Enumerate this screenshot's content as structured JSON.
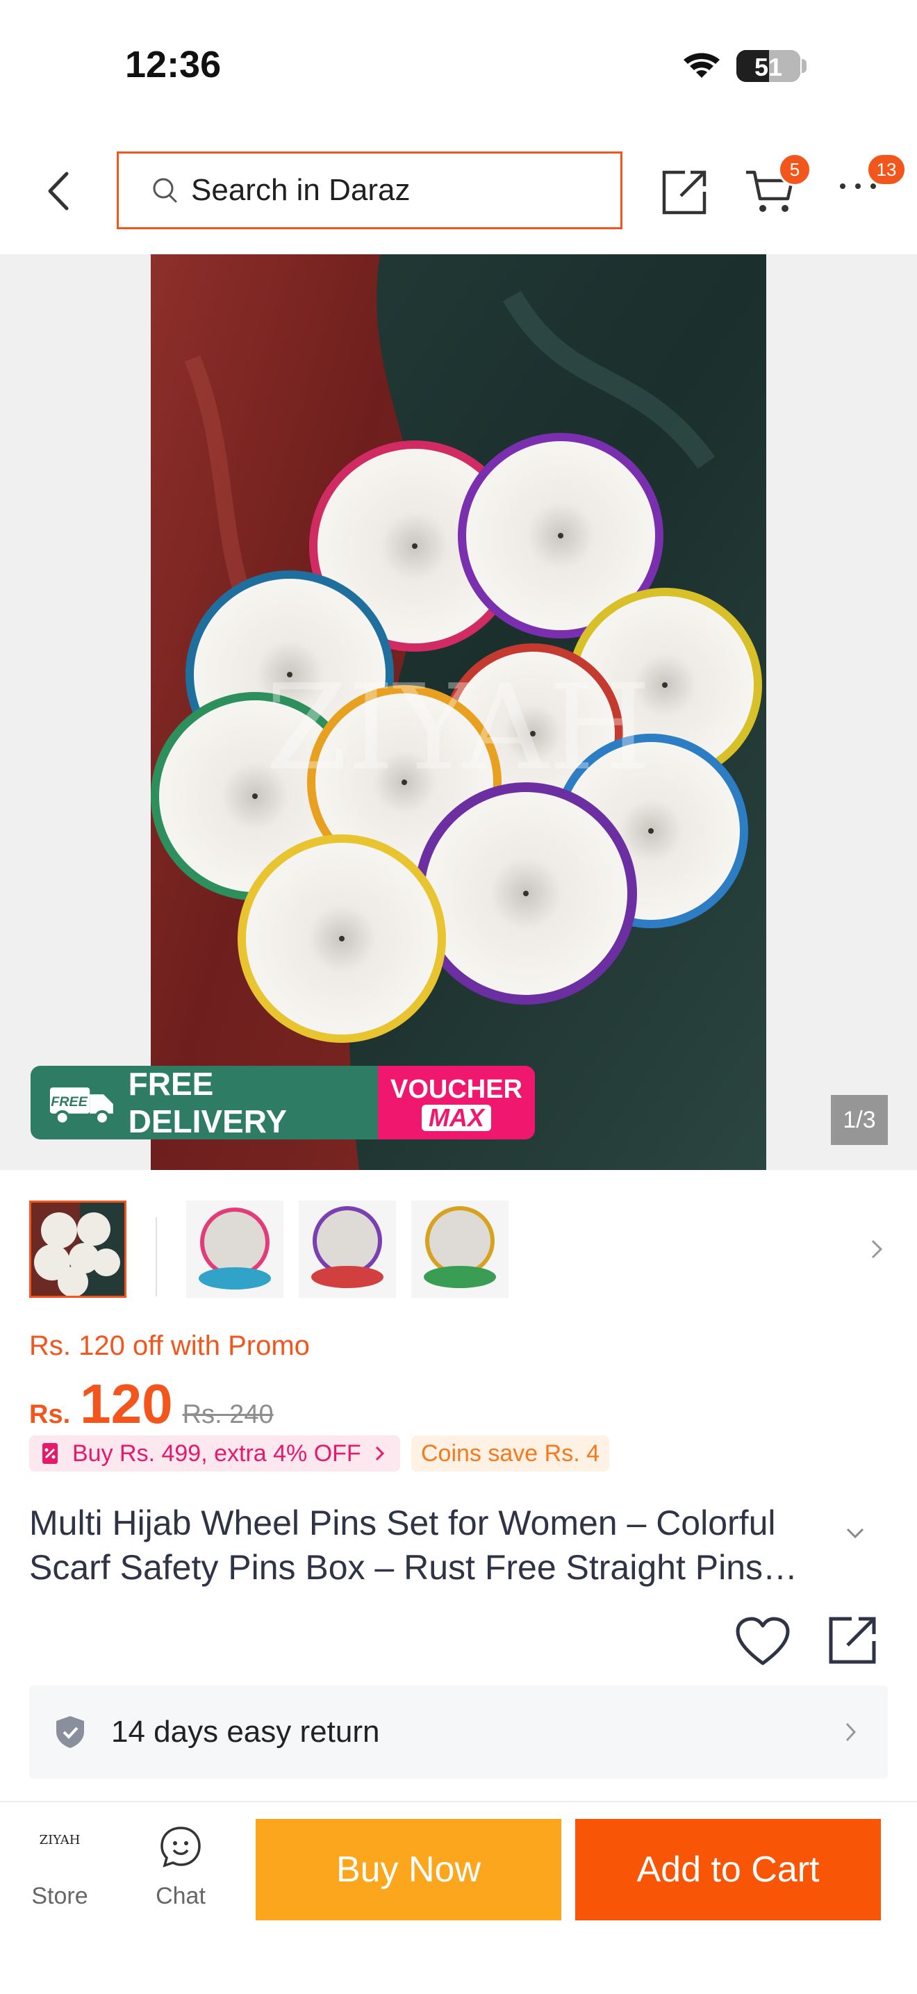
{
  "status_bar": {
    "time": "12:36",
    "battery": "51",
    "battery_level": 0.51
  },
  "header": {
    "search_placeholder": "Search in Daraz",
    "cart_badge": "5",
    "more_badge": "13"
  },
  "hero": {
    "watermark": "ZIYAH",
    "counter": "1/3",
    "banner_free": "FREE",
    "banner_delivery": "FREE DELIVERY",
    "banner_voucher": "VOUCHER",
    "banner_max": "MAX"
  },
  "price": {
    "promo_text": "Rs. 120 off with Promo",
    "currency": "Rs.",
    "value": "120",
    "old": "Rs. 240",
    "buy_more": "Buy Rs. 499, extra 4% OFF",
    "coins": "Coins save Rs. 4"
  },
  "product": {
    "title": "Multi Hijab Wheel Pins Set for Women – Colorful Scarf Safety Pins Box – Rust Free Straight Pins…"
  },
  "return": {
    "label": "14 days easy return"
  },
  "bottom": {
    "store_logo": "ZIYAH",
    "store_label": "Store",
    "chat_label": "Chat",
    "buy_now": "Buy Now",
    "add_to_cart": "Add to Cart"
  },
  "colors": {
    "accent": "#f85606",
    "buy_now": "#fba61d",
    "voucher": "#f0186e",
    "delivery": "#2d7c63"
  }
}
